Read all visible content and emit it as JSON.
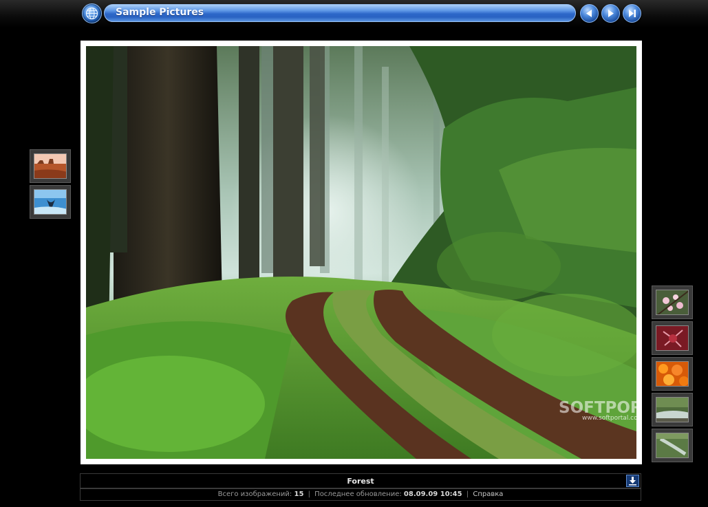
{
  "header": {
    "title": "Sample Pictures",
    "icons": {
      "home": "globe-grid-icon",
      "prev": "previous-icon",
      "play": "play-icon",
      "next": "next-end-icon"
    },
    "accent_color": "#2c67c9"
  },
  "main_image": {
    "caption": "Forest",
    "watermark_logo": "SOFTPORTAL",
    "watermark_url": "www.softportal.com"
  },
  "thumbnails_left": [
    {
      "name": "Desert thumbnail"
    },
    {
      "name": "Whale tail thumbnail"
    }
  ],
  "thumbnails_right": [
    {
      "name": "Flowering tree thumbnail"
    },
    {
      "name": "Red leaves thumbnail"
    },
    {
      "name": "Orange flowers thumbnail"
    },
    {
      "name": "Waterfall thumbnail"
    },
    {
      "name": "Creek thumbnail"
    }
  ],
  "footer": {
    "download_icon": "download-icon",
    "total_label": "Всего изображений:",
    "total_value": "15",
    "updated_label": "Последнее обновление:",
    "updated_value": "08.09.09 10:45",
    "separator": "|",
    "help_link": "Справка"
  }
}
